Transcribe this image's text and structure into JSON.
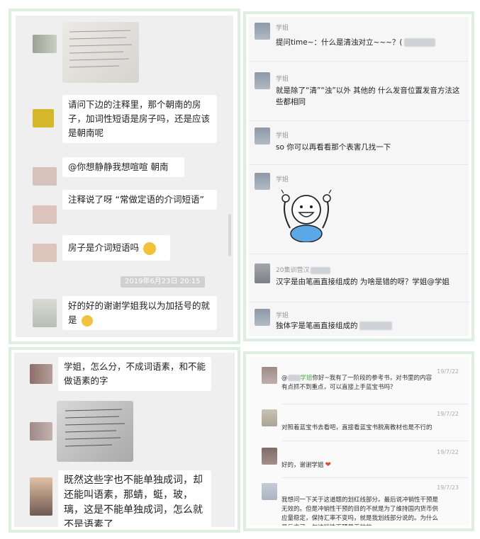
{
  "panel_tl": {
    "messages": [
      {
        "text": "请问下边的注释里，那个朝南的房子，加词性短语是房子吗，还是应该是朝南呢"
      },
      {
        "text": "@你想静静我想喧喧 朝南"
      },
      {
        "text": "注释说了呀 “常做定语的介词短语”"
      },
      {
        "text": "房子是介词短语吗"
      },
      {
        "text": "好的好的谢谢学姐我以为加括号的就是"
      }
    ],
    "timestamp": "2019年6月23日 20:15"
  },
  "panel_tr": {
    "items": [
      {
        "name": "学姐",
        "text": "提问time~：什么是清浊对立~~~？("
      },
      {
        "name": "学姐",
        "text": "就是除了“清”“浊”以外 其他的 什么发音位置发音方法这些都相同"
      },
      {
        "name": "学姐",
        "text": "so 你可以再看看那个表害几找一下"
      },
      {
        "name": "学姐",
        "text": ""
      },
      {
        "name": "20集训营汉",
        "text": "汉字是由笔画直接组成的 为啥是错的呀？学姐@学姐"
      },
      {
        "name": "学姐",
        "text": "独体字是笔画直接组成的"
      }
    ]
  },
  "panel_bl": {
    "messages": [
      {
        "text": "学姐，怎么分，不成词语素，和不能做语素的字"
      },
      {
        "text": "既然这些字也不能单独成词，却还能叫语素，那蜻，蜓，玻，璃，这是不能单独成词，怎么就不是语素了"
      }
    ]
  },
  "panel_br": {
    "comments": [
      {
        "date": "19/7/22",
        "mention": "学姐",
        "text": "你好~我有了一阶段的参考书，对书里的内容有点抓不到重点，可以直接上手蓝宝书吗？"
      },
      {
        "date": "19/7/22",
        "text": "对照着蓝宝书去看吧，直接看蓝宝书脱离教材也是不行的"
      },
      {
        "date": "19/7/22",
        "text": "好的，谢谢学姐"
      },
      {
        "date": "19/7/23",
        "text": "我想问一下关于这道题的划红线部分。最后说冲销性干预是无效的。但是冲销性干预的目的不就是为了维持国内货币供应量稳定，保持汇率不变吗，就是我划线部分说的。为什么最后来了一句冲销性干预是无效的"
      }
    ]
  },
  "colors": {
    "frame": "#dcefe0",
    "chat_bg": "#efefef",
    "mention": "#4caf50",
    "heart": "#e0483a"
  }
}
